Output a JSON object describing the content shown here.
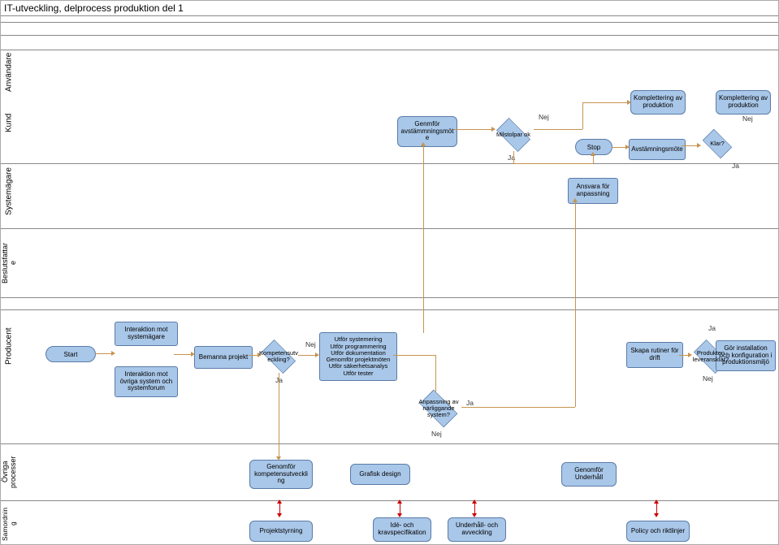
{
  "title": "IT-utveckling, delprocess produktion del 1",
  "lanes": {
    "anvandare": "Användare",
    "kund": "Kund",
    "systemagare": "Systemägare",
    "beslutsfattare": "Beslutsfattar\ne",
    "producent": "Producent",
    "ovriga": "Övriga\nprocesser",
    "samordning": "Samordnin\ng"
  },
  "nodes": {
    "genmfor_avst": "Genmför\navstämmningsmöt\ne",
    "milstolpar_ok": "Milstolpar ok",
    "stop": "Stop",
    "avstamning": "Avstämningsmöte",
    "klar": "Klar?",
    "kompl1": "Komplettering av\nproduktion",
    "kompl2": "Komplettering av\nproduktion",
    "ansvara": "Ansvara för\nanpassning",
    "start": "Start",
    "interaktion1": "Interaktion mot\nsystemägare",
    "interaktion2": "Interaktion mot\növriga system och\nsystemforum",
    "bemanna": "Bemanna projekt",
    "kompetens": "Kompetensutv\neckling?",
    "utfor": "Utför systemering\nUtför programmering\nUtför dokumentation\nGenomför projektmöten\nUtför säkerhetsanalys\nUtför tester",
    "anpassning": "Anpassning av\nnärliggande\nsystem?",
    "skapa": "Skapa rutiner för\ndrift",
    "produkten": "Produkten\nleveransklar?",
    "gor_install": "Gör installation\noch konfiguration i\nproduktionsmiljö",
    "genomfor_komp": "Genomför\nkompetensutveckli\nng",
    "grafisk": "Grafisk design",
    "genomfor_underhall": "Genomför\nUnderhåll",
    "projektstyrning": "Projektstyrning",
    "ide": "Idé- och\nkravspecifikation",
    "underhall_avv": "Underhåll- och\navveckling",
    "policy": "Policy och riktlinjer"
  },
  "labels": {
    "ja": "Ja",
    "nej": "Nej"
  }
}
